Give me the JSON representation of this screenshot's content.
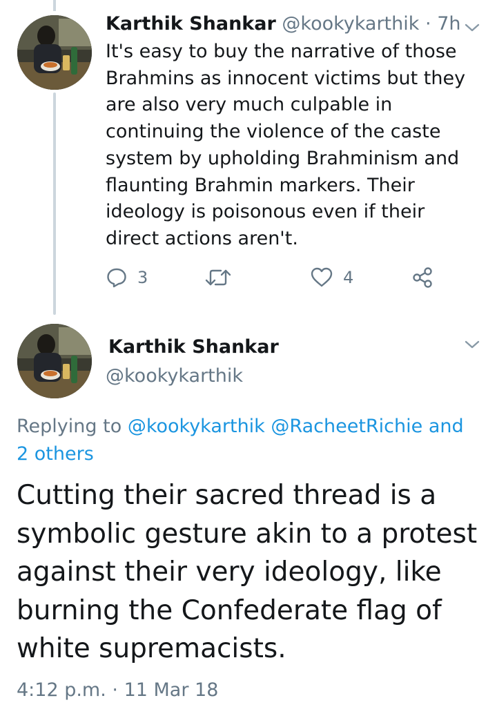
{
  "tweet1": {
    "display_name": "Karthik Shankar",
    "handle": "@kookykarthik",
    "separator": "·",
    "relative_time": "7h",
    "text": "It's easy to buy the narrative of those Brahmins as innocent victims but they are also very much culpable in continuing the violence of the caste system by upholding Brahminism and flaunting Brahmin markers. Their ideology is poisonous even if their direct actions aren't.",
    "actions": {
      "reply_count": "3",
      "retweet_count": "",
      "like_count": "4"
    }
  },
  "tweet2": {
    "display_name": "Karthik Shankar",
    "handle": "@kookykarthik",
    "replying_prefix": "Replying to",
    "replying_mention_1": "@kookykarthik",
    "replying_mention_2": "@RacheetRichie",
    "replying_and": "and 2 others",
    "text": "Cutting their sacred thread is a symbolic gesture akin to a protest against their very ideology, like burning the Confederate flag of white supremacists.",
    "timestamp": "4:12 p.m. · 11 Mar 18"
  },
  "icons": {
    "reply": "reply-icon",
    "retweet": "retweet-icon",
    "like": "heart-icon",
    "share": "share-icon",
    "menu": "chevron-down-icon"
  },
  "colors": {
    "text": "#14171a",
    "secondary": "#657786",
    "link": "#1b95e0",
    "thread_line": "#ccd6dd"
  }
}
